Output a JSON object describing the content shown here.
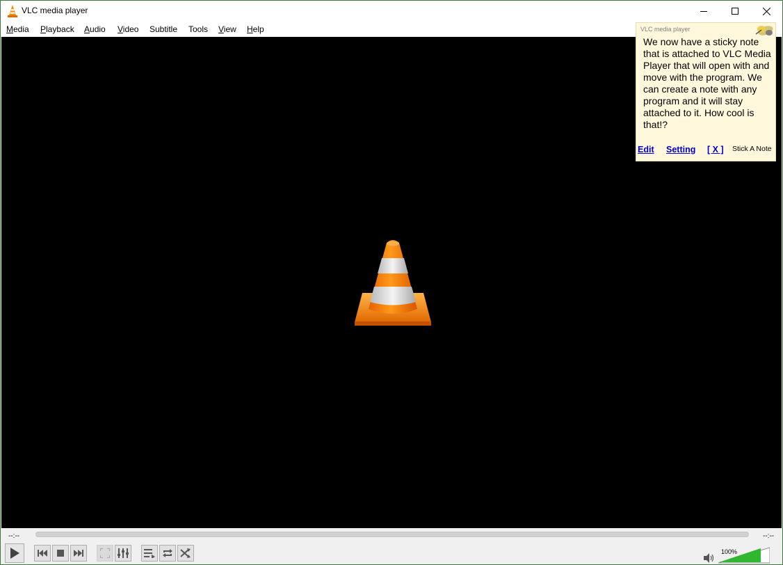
{
  "window": {
    "title": "VLC media player",
    "controls": [
      "minimize-icon",
      "maximize-icon",
      "close-icon"
    ]
  },
  "menubar": {
    "items": [
      {
        "key": "M",
        "rest": "edia"
      },
      {
        "key": "P",
        "rest": "layback"
      },
      {
        "key": "A",
        "rest": "udio"
      },
      {
        "key": "V",
        "rest": "ideo"
      },
      {
        "key": "",
        "rest": "Subtitle"
      },
      {
        "key": "",
        "rest": "Tools"
      },
      {
        "key": "V",
        "rest": "iew"
      },
      {
        "key": "H",
        "rest": "elp"
      }
    ]
  },
  "sticky_note": {
    "header": "VLC media player",
    "body": "We now have a sticky note that is attached to VLC Media Player that will open with and move with the program. We can create a note with any program and it will stay attached to it. How cool is that!?",
    "links": {
      "edit": "Edit",
      "setting": "Setting",
      "close": "[ X ]"
    },
    "stick_label": "Stick A Note",
    "background": "#fff8dc"
  },
  "controls": {
    "time_elapsed": "--:--",
    "time_remaining": "--:--",
    "volume_label": "100%",
    "volume_level": 1.0,
    "buttons": [
      "play-icon",
      "previous-icon",
      "stop-icon",
      "next-icon",
      "fullscreen-icon",
      "extended-settings-icon",
      "playlist-icon",
      "loop-icon",
      "shuffle-icon"
    ]
  },
  "colors": {
    "accent": "#ff8800",
    "volume_green": "#2fb82f",
    "link": "#0000cc"
  }
}
